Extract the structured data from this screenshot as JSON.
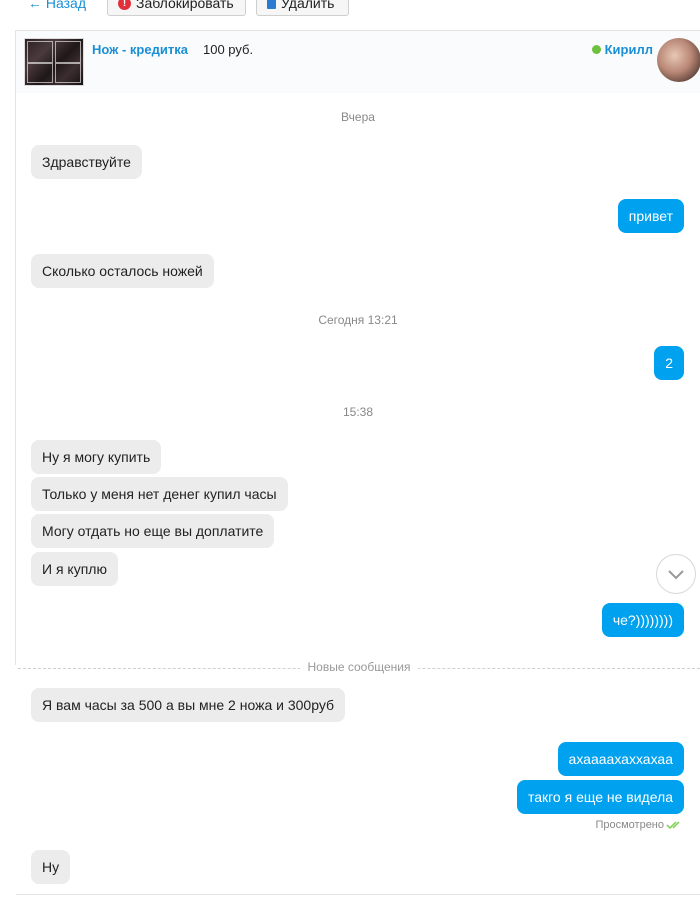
{
  "toolbar": {
    "back_label": "← Назад",
    "block_label": "Заблокировать",
    "delete_label": "Удалить"
  },
  "header": {
    "item_title": "Нож - кредитка",
    "item_price": "100 руб.",
    "seller_name": "Кирилл",
    "status_color": "#6cc23f"
  },
  "separators": {
    "yesterday": "Вчера",
    "today": "Сегодня 13:21",
    "time": "15:38"
  },
  "messages": [
    {
      "dir": "in",
      "text": "Здравствуйте"
    },
    {
      "dir": "out",
      "text": "привет"
    },
    {
      "dir": "in",
      "text": "Сколько осталось ножей"
    },
    {
      "dir": "out",
      "text": "2"
    },
    {
      "dir": "in",
      "text": "Ну я могу купить"
    },
    {
      "dir": "in",
      "text": "Только у меня нет денег купил часы"
    },
    {
      "dir": "in",
      "text": "Могу отдать но еще вы доплатите"
    },
    {
      "dir": "in",
      "text": "И я куплю"
    },
    {
      "dir": "out",
      "text": "че?))))))))"
    },
    {
      "dir": "in",
      "text": "Я вам часы за 500 а вы мне 2 ножа и 300руб"
    },
    {
      "dir": "out",
      "text": "ахаааахаххахаа"
    },
    {
      "dir": "out",
      "text": "такго я еще не видела"
    },
    {
      "dir": "in",
      "text": "Ну"
    }
  ],
  "new_messages_label": "Новые сообщения",
  "seen_label": "Просмотрено",
  "colors": {
    "accent": "#1a8fd6",
    "outgoing_bubble": "#00a2ef",
    "incoming_bubble": "#ececec",
    "seen_check": "#7ccf4a"
  }
}
